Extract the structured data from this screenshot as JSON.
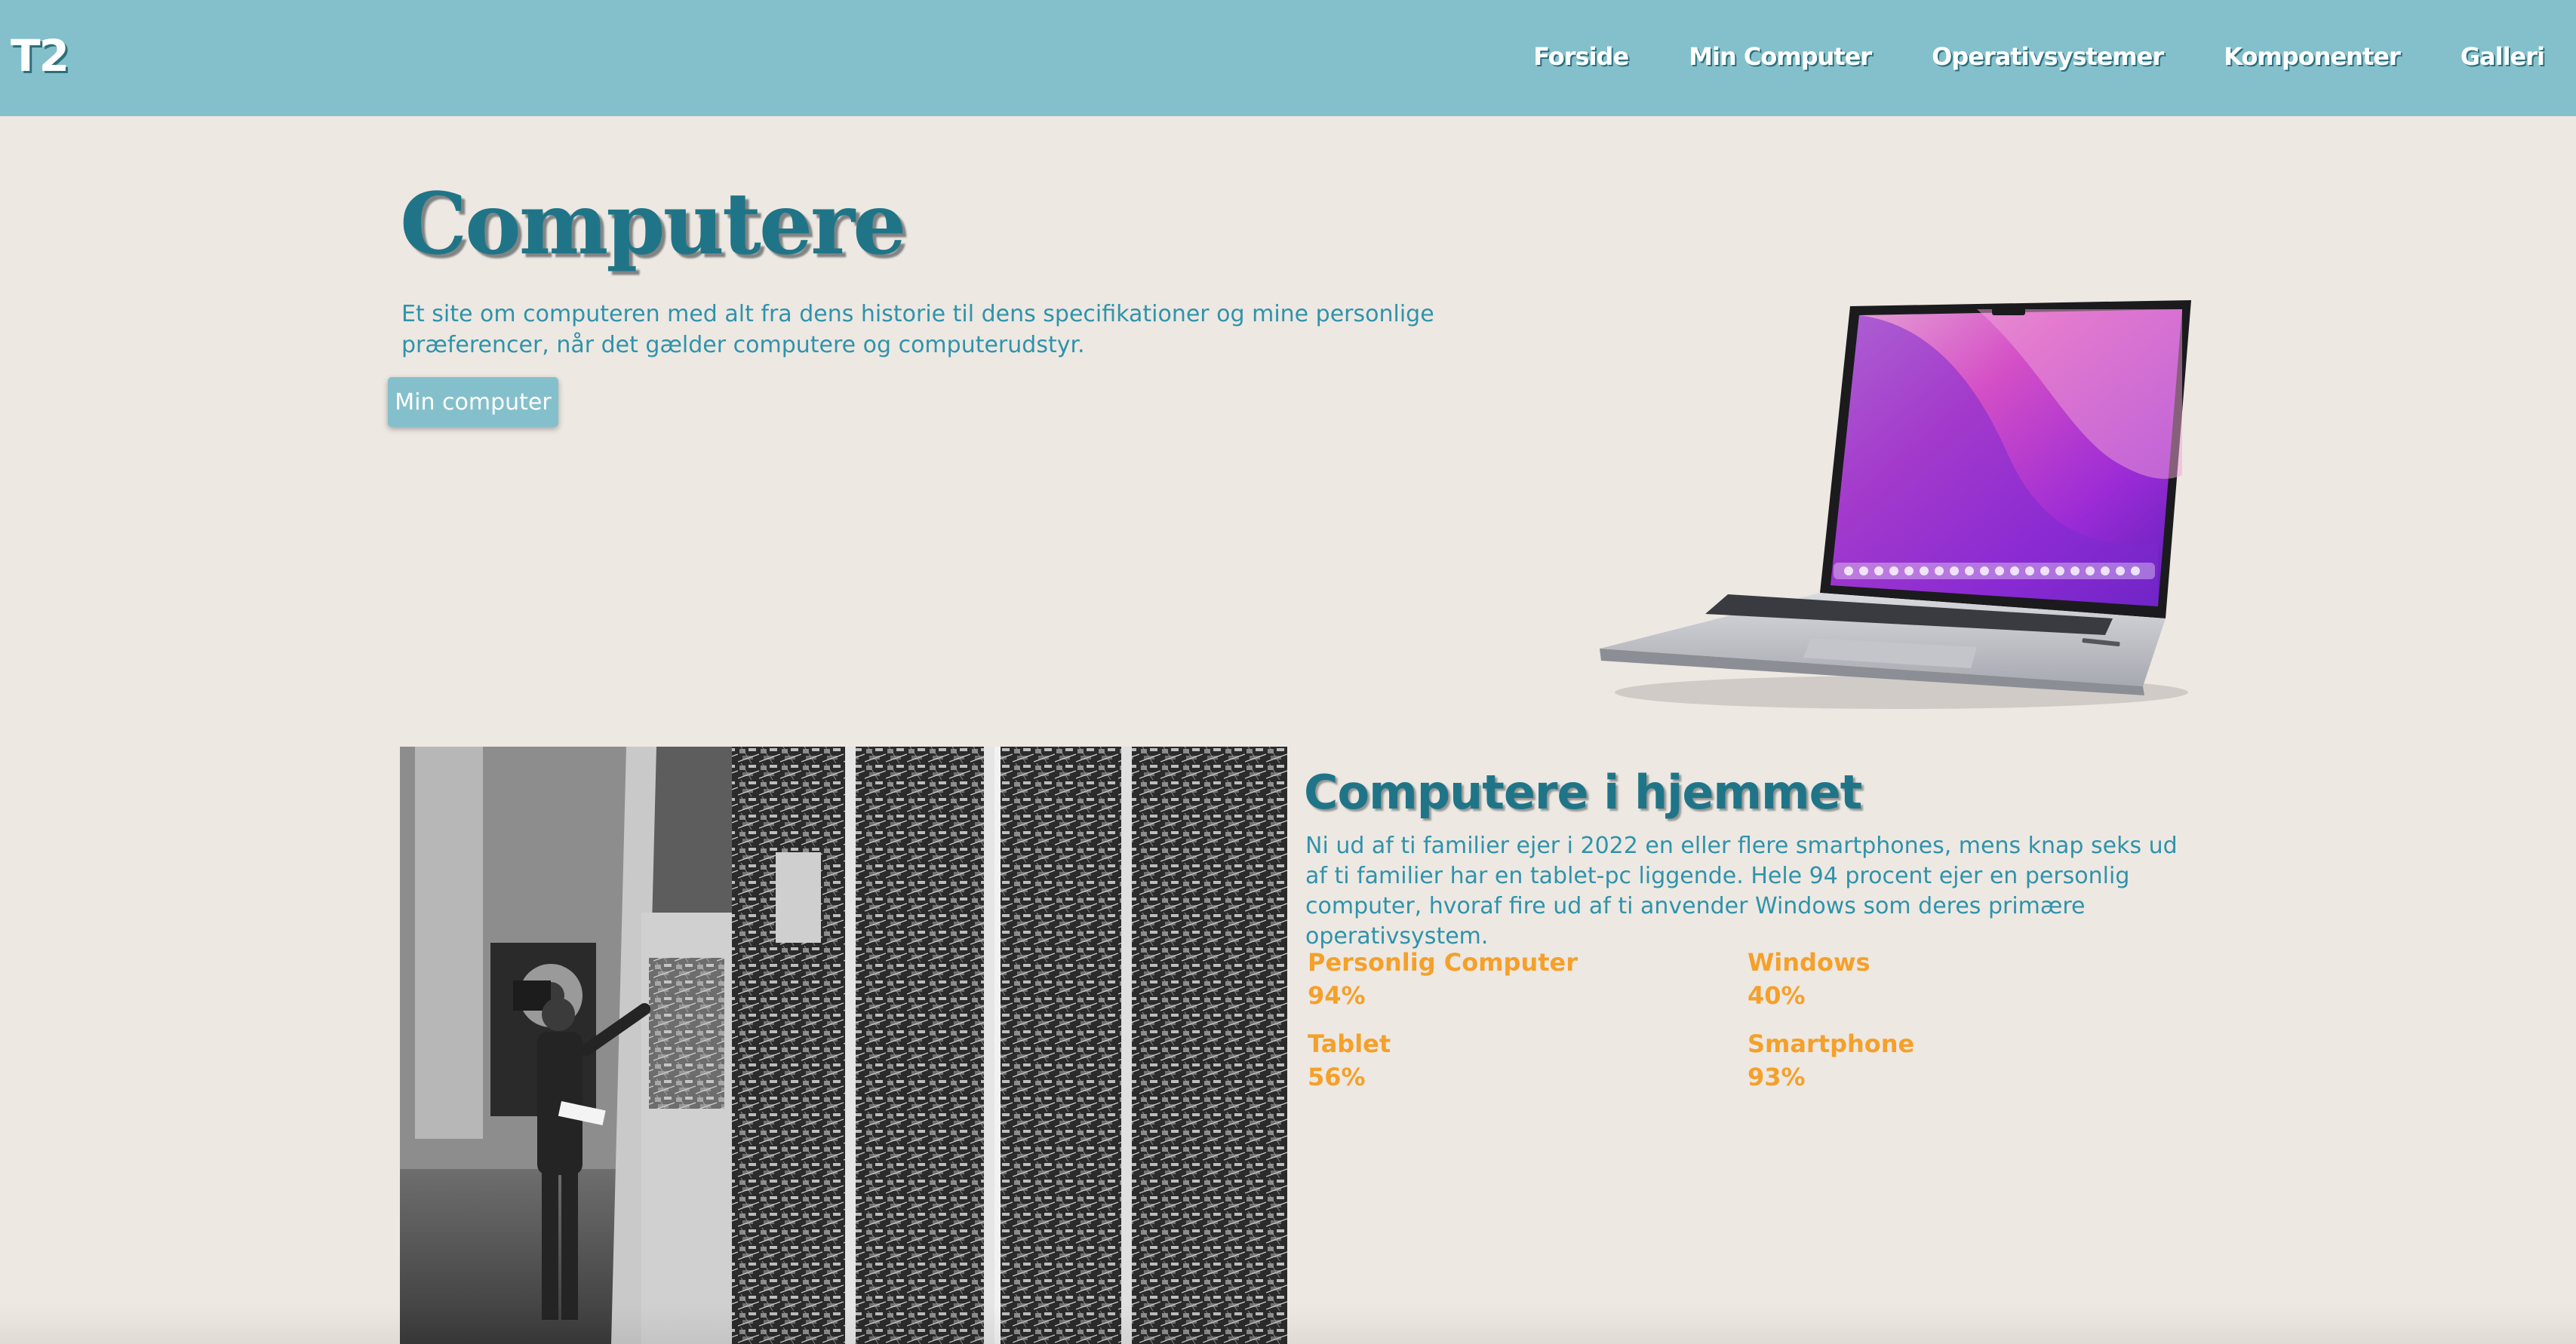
{
  "nav": {
    "logo": "T2",
    "links": [
      "Forside",
      "Min Computer",
      "Operativsystemer",
      "Komponenter",
      "Galleri"
    ]
  },
  "hero": {
    "title": "Computere",
    "description": "Et site om computeren med alt fra dens historie til dens specifikationer og mine personlige præferencer, når det gælder computere og computerudstyr.",
    "button_label": "Min computer"
  },
  "section": {
    "title": "Computere i hjemmet",
    "description": "Ni ud af ti familier ejer i 2022 en eller flere smartphones, mens knap seks ud af ti familier har en tablet-pc liggende. Hele 94 procent ejer en personlig computer, hvoraf fire ud af ti anvender Windows som deres primære operativsystem.",
    "stats": [
      {
        "label": "Personlig Computer",
        "value": "94%"
      },
      {
        "label": "Windows",
        "value": "40%"
      },
      {
        "label": "Tablet",
        "value": "56%"
      },
      {
        "label": "Smartphone",
        "value": "93%"
      }
    ]
  },
  "colors": {
    "navbar": "#84c0cb",
    "background": "#ede8e2",
    "heading": "#1f7587",
    "body_text": "#2f93ab",
    "stat_text": "#f5a02a"
  },
  "icons": {
    "laptop_image": "laptop-image",
    "mainframe_photo": "mainframe-photo"
  }
}
